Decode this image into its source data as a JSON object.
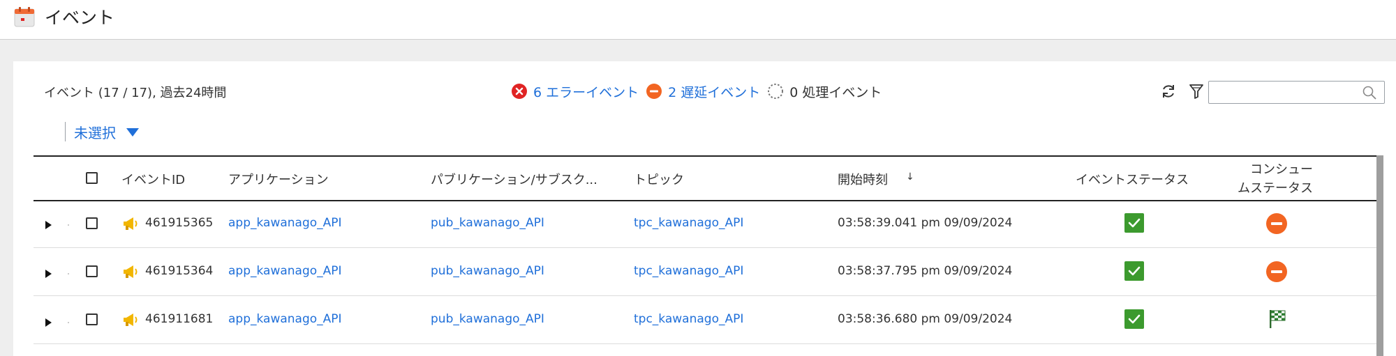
{
  "app": {
    "title": "イベント",
    "icon": "calendar-icon"
  },
  "summary": {
    "text": "イベント (17 / 17), 過去24時間"
  },
  "status": {
    "error": {
      "count_label": "6 エラーイベント",
      "icon": "error-x-icon",
      "color": "#e02424"
    },
    "delay": {
      "count_label": "2 遅延イベント",
      "icon": "delay-minus-icon",
      "color": "#f26522"
    },
    "processing": {
      "count_label": "0 処理イベント",
      "icon": "processing-spinner-icon"
    }
  },
  "toolbar": {
    "refresh_icon": "refresh-icon",
    "filter_icon": "filter-icon",
    "search_placeholder": "",
    "search_icon": "search-icon"
  },
  "filter": {
    "label": "未選択",
    "icon": "caret-down-icon"
  },
  "table": {
    "headers": {
      "event_id": "イベントID",
      "application": "アプリケーション",
      "pubsub": "パブリケーション/サブスク...",
      "topic": "トピック",
      "start_time": "開始時刻",
      "sort_indicator": "↓",
      "event_status": "イベントステータス",
      "consume_status_line1": "コンシュー",
      "consume_status_line2": "ムステータス"
    },
    "rows": [
      {
        "event_id": "461915365",
        "application": "app_kawanago_API",
        "pubsub": "pub_kawanago_API",
        "topic": "tpc_kawanago_API",
        "start_time": "03:58:39.041 pm 09/09/2024",
        "event_status": "success",
        "consume_status": "delayed"
      },
      {
        "event_id": "461915364",
        "application": "app_kawanago_API",
        "pubsub": "pub_kawanago_API",
        "topic": "tpc_kawanago_API",
        "start_time": "03:58:37.795 pm 09/09/2024",
        "event_status": "success",
        "consume_status": "delayed"
      },
      {
        "event_id": "461911681",
        "application": "app_kawanago_API",
        "pubsub": "pub_kawanago_API",
        "topic": "tpc_kawanago_API",
        "start_time": "03:58:36.680 pm 09/09/2024",
        "event_status": "success",
        "consume_status": "completed"
      }
    ]
  },
  "colors": {
    "link": "#1f6fd9",
    "success": "#3c9a2e",
    "delay": "#f26522",
    "error": "#e02424",
    "megaphone": "#f2b600"
  }
}
